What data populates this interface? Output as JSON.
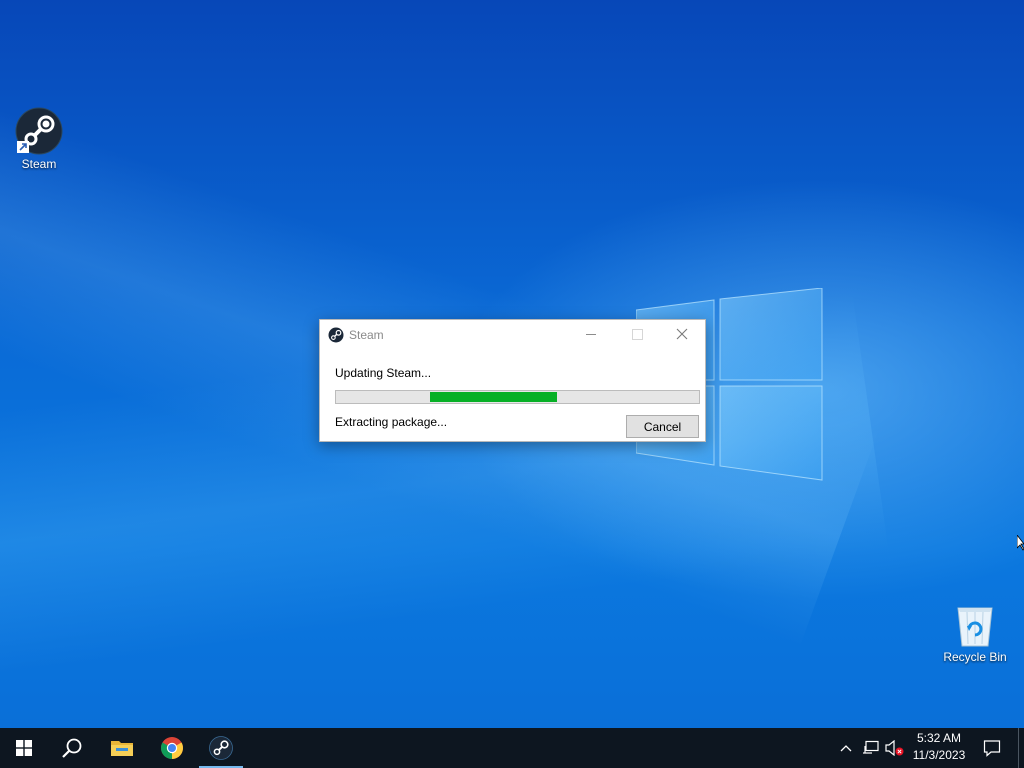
{
  "desktop": {
    "icons": [
      {
        "label": "Steam",
        "icon": "steam-icon"
      },
      {
        "label": "Recycle Bin",
        "icon": "recycle-bin-icon"
      }
    ]
  },
  "dialog": {
    "title": "Steam",
    "status": "Updating Steam...",
    "progress_range": [
      0.26,
      0.61
    ],
    "detail": "Extracting package...",
    "cancel_label": "Cancel",
    "progress_color": "#06b025"
  },
  "taskbar": {
    "items": [
      {
        "name": "start",
        "icon": "windows-start-icon"
      },
      {
        "name": "search",
        "icon": "search-icon"
      },
      {
        "name": "file-explorer",
        "icon": "folder-icon"
      },
      {
        "name": "chrome",
        "icon": "chrome-icon"
      },
      {
        "name": "steam",
        "icon": "steam-icon",
        "active": true
      }
    ],
    "tray": {
      "icons": [
        "chevron-up-icon",
        "network-icon",
        "volume-muted-icon",
        "notification-icon"
      ],
      "time": "5:32 AM",
      "date": "11/3/2023"
    }
  }
}
